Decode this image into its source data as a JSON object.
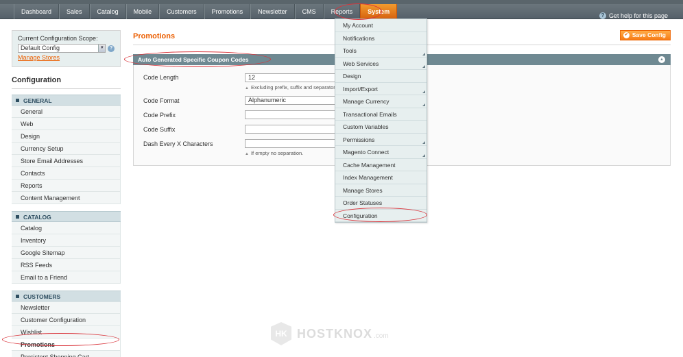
{
  "nav": {
    "items": [
      "Dashboard",
      "Sales",
      "Catalog",
      "Mobile",
      "Customers",
      "Promotions",
      "Newsletter",
      "CMS",
      "Reports",
      "System"
    ],
    "active": "System",
    "help": "Get help for this page"
  },
  "scope": {
    "label": "Current Configuration Scope:",
    "value": "Default Config",
    "manage_link": "Manage Stores"
  },
  "sidebar": {
    "title": "Configuration",
    "sections": [
      {
        "title": "GENERAL",
        "items": [
          "General",
          "Web",
          "Design",
          "Currency Setup",
          "Store Email Addresses",
          "Contacts",
          "Reports",
          "Content Management"
        ]
      },
      {
        "title": "CATALOG",
        "items": [
          "Catalog",
          "Inventory",
          "Google Sitemap",
          "RSS Feeds",
          "Email to a Friend"
        ]
      },
      {
        "title": "CUSTOMERS",
        "items": [
          "Newsletter",
          "Customer Configuration",
          "Wishlist",
          "Promotions",
          "Persistent Shopping Cart"
        ]
      }
    ],
    "active_item": "Promotions"
  },
  "main": {
    "title": "Promotions",
    "save_label": "Save Config",
    "fieldset_title": "Auto Generated Specific Coupon Codes",
    "fields": [
      {
        "label": "Code Length",
        "value": "12",
        "note": "Excluding prefix, suffix and separators."
      },
      {
        "label": "Code Format",
        "value": "Alphanumeric",
        "note": ""
      },
      {
        "label": "Code Prefix",
        "value": "",
        "note": ""
      },
      {
        "label": "Code Suffix",
        "value": "",
        "note": ""
      },
      {
        "label": "Dash Every X Characters",
        "value": "",
        "note": "If empty no separation."
      }
    ]
  },
  "system_menu": {
    "items": [
      {
        "label": "My Account",
        "submenu": false
      },
      {
        "label": "Notifications",
        "submenu": false
      },
      {
        "label": "Tools",
        "submenu": true
      },
      {
        "label": "Web Services",
        "submenu": true
      },
      {
        "label": "Design",
        "submenu": false
      },
      {
        "label": "Import/Export",
        "submenu": true
      },
      {
        "label": "Manage Currency",
        "submenu": true
      },
      {
        "label": "Transactional Emails",
        "submenu": false
      },
      {
        "label": "Custom Variables",
        "submenu": false
      },
      {
        "label": "Permissions",
        "submenu": true
      },
      {
        "label": "Magento Connect",
        "submenu": true
      },
      {
        "label": "Cache Management",
        "submenu": false
      },
      {
        "label": "Index Management",
        "submenu": false
      },
      {
        "label": "Manage Stores",
        "submenu": false
      },
      {
        "label": "Order Statuses",
        "submenu": false
      },
      {
        "label": "Configuration",
        "submenu": false
      }
    ]
  },
  "watermark": {
    "logo": "HK",
    "text": "HOSTKNOX",
    "suffix": ".com"
  },
  "colors": {
    "accent": "#eb5e00",
    "nav_active": "#f39b2e",
    "fieldset_head": "#6f8992",
    "annotation": "#d9343b"
  }
}
